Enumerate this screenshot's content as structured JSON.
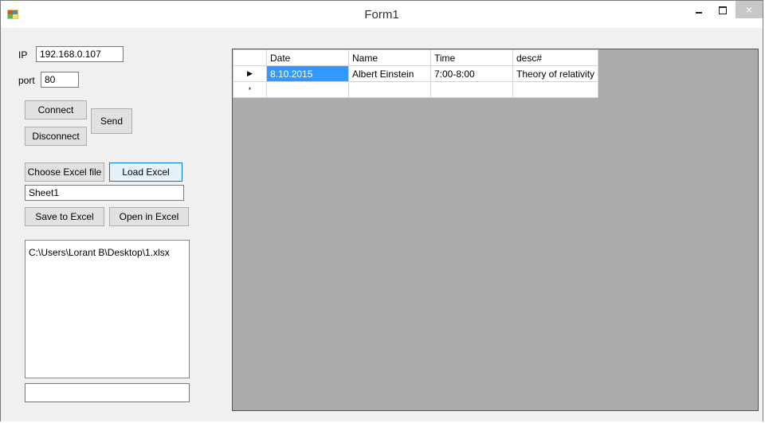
{
  "window": {
    "title": "Form1",
    "close_glyph": "×"
  },
  "connection": {
    "ip_label": "IP",
    "ip_value": "192.168.0.107",
    "port_label": "port",
    "port_value": "80",
    "connect_label": "Connect",
    "disconnect_label": "Disconnect",
    "send_label": "Send"
  },
  "excel": {
    "choose_label": "Choose Excel file",
    "load_label": "Load Excel",
    "sheet_value": "Sheet1",
    "save_label": "Save to Excel",
    "open_label": "Open in Excel"
  },
  "log": {
    "lines": [
      "C:\\Users\\Lorant B\\Desktop\\1.xlsx"
    ],
    "bottom_value": ""
  },
  "grid": {
    "columns": [
      "Date",
      "Name",
      "Time",
      "desc#"
    ],
    "rows": [
      {
        "marker": "▶",
        "cells": [
          "8.10.2015",
          "Albert Einstein",
          "7:00-8:00",
          "Theory of relativity"
        ]
      },
      {
        "marker": "*",
        "cells": [
          "",
          "",
          "",
          ""
        ]
      }
    ]
  },
  "colors": {
    "selection": "#3399ff",
    "grid_background": "#ababab",
    "focus_border": "#0078d7"
  }
}
